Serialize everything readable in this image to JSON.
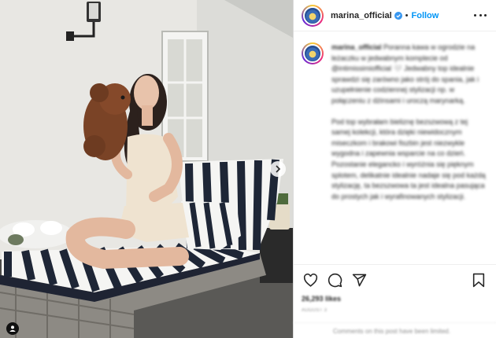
{
  "post": {
    "username": "marina_official",
    "follow_label": "Follow",
    "dot": "•",
    "caption_user": "marina_official",
    "caption_paragraphs": [
      "Poranna kawa w ogrodzie na leżaczku w jedwabnym komplecie od @intimissimiofficial 🤍 Jedwabny top idealnie sprawdzi się zarówno jako strój do spania, jak i uzupełnienie codziennej stylizacji np. w połączeniu z dżinsami i uroczą marynarką.",
      "Pod top wybrałam bieliznę bezszwową z tej samej kolekcji, która dzięki niewidocznym miseczkom i brakowi fiszbin jest niezwykle wygodna i zapewnia wsparcie na co dzień. Pozostanie elegancko i wyróżnia się pięknym splotem, delikatnie idealnie nadaje się pod każdą stylizację, ta bezszwowa ta jest idealna pasująca do prostych jak i wyrafinowanych stylizacji."
    ],
    "likes_text": "26,293 likes",
    "date_text": "August 3",
    "comment_placeholder": "Comments on this post have been limited."
  },
  "colors": {
    "link": "#0095f6",
    "text": "#262626",
    "muted": "#8e8e8e",
    "mention": "#00376b"
  },
  "icons": [
    "verified-badge-icon",
    "more-options-icon",
    "heart-icon",
    "comment-icon",
    "share-icon",
    "bookmark-icon",
    "next-arrow-icon",
    "user-tag-icon"
  ]
}
